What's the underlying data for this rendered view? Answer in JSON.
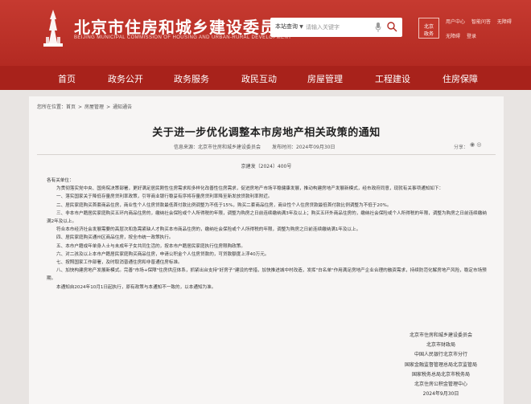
{
  "header": {
    "title_cn": "北京市住房和城乡建设委员会",
    "title_en": "BEIJING MUNICIPAL COMMISSION OF HOUSING AND URBAN-RURAL DEVELOPMENT",
    "search_scope": "本站查询",
    "search_placeholder": "请输入关键字",
    "badge": [
      "北京",
      "政务"
    ],
    "links_row1": [
      "用户中心",
      "智能问答",
      "无障碍"
    ],
    "links_row2": [
      "无障碍",
      "登录"
    ]
  },
  "nav": [
    "首页",
    "政务公开",
    "政务服务",
    "政民互动",
    "房屋管理",
    "工程建设",
    "住房保障"
  ],
  "breadcrumb": [
    "您所在位置：首页",
    "房屋管理",
    "通知通告"
  ],
  "doc": {
    "title": "关于进一步优化调整本市房地产相关政策的通知",
    "source_label": "信息来源：北京市住房和城乡建设委员会",
    "date_label": "发布时间：2024年09月30日",
    "share_label": "分享：",
    "doc_no": "京建发〔2024〕400号",
    "greeting": "各有关单位：",
    "paragraphs": [
      "为贯彻落实党中央、国务院决策部署，更好满足居民刚性住房需求和多样化改善性住房需求，促进房地产市场平稳健康发展，推动构建房地产发展新模式，经市政府同意，现就有关事项通知如下：",
      "一、落实国家关于降低存量房贷利率政策，引导商业银行稳妥有序将存量房贷利率降至新发放贷款利率附近。",
      "二、居民家庭购买首套商品住房，商业性个人住房贷款最低首付款比例调整为不低于15%，购买二套商品住房，商业性个人住房贷款最低首付款比例调整为不低于20%。",
      "三、非本市户籍居民家庭购买五环内商品住房的，缴纳社会保险或个人所得税的年限，调整为购房之日前连续缴纳满3年及以上；购买五环外商品住房的，缴纳社会保险或个人所得税的年限，调整为购房之日前连续缴纳满2年及以上。",
      "符合本市经济社会发展需要的高层次和急需紧缺人才购买本市商品住房的，缴纳社会保险或个人所得税的年限，调整为购房之日前连续缴纳满1年及以上。",
      "四、居民家庭购买通州区商品住房，按全市统一政策执行。",
      "五、本市户籍成年单身人士与未成年子女共同生活的，按本市户籍居民家庭执行住房限购政策。",
      "六、对二孩及以上本市户籍居民家庭购买商品住房，申请公积金个人住房贷款的，可贷款额度上浮40万元。",
      "七、按照国家工作部署，及时取消普通住房和非普通住房标准。",
      "八、加快构建房地产发展新模式。完善\"市场+保障\"住房供应体系，抓紧出台支持\"好房子\"建设的举措，加快推进城中村改造，发挥\"白名单\"作用满足房地产企业合理的融资需求，持续防范化解房地产风险，稳定市场预期。",
      "本通知自2024年10月1日起执行，原有政策与本通知不一致的，以本通知为准。"
    ],
    "signatories": [
      "北京市住房和城乡建设委员会",
      "北京市财政局",
      "中国人民银行北京市分行",
      "国家金融监督管理总局北京监管局",
      "国家税务总局北京市税务局",
      "北京住房公积金管理中心",
      "2024年9月30日"
    ]
  },
  "colors": {
    "header": "#b32a22",
    "nav": "#a8221b",
    "page": "#f7f5f4"
  }
}
